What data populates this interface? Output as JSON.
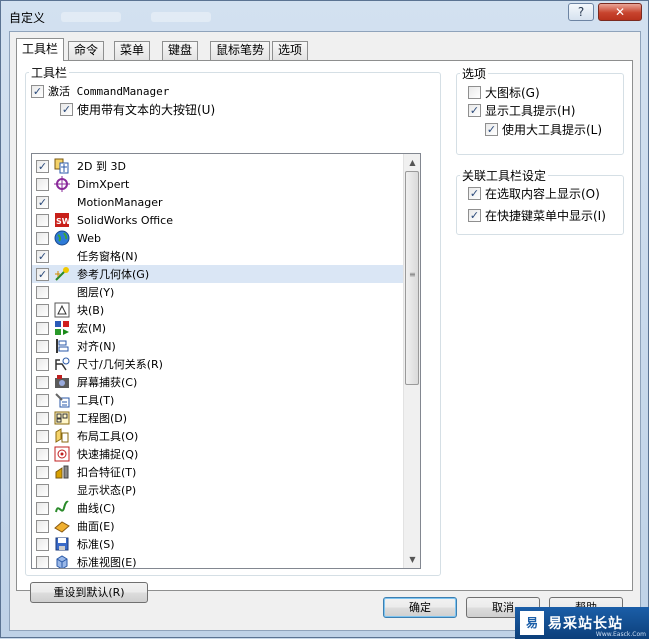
{
  "window": {
    "title": "自定义",
    "help_glyph": "?",
    "close_glyph": "✕"
  },
  "tabs": [
    {
      "label": "工具栏",
      "active": true
    },
    {
      "label": "命令",
      "active": false
    },
    {
      "label": "菜单",
      "active": false
    },
    {
      "label": "键盘",
      "active": false
    },
    {
      "label": "鼠标笔势",
      "active": false
    },
    {
      "label": "选项",
      "active": false
    }
  ],
  "toolbars_group": {
    "label": "工具栏",
    "activate_cm": {
      "label": "激活 CommandManager",
      "checked": true
    },
    "large_buttons_text": {
      "label": "使用带有文本的大按钮(U)",
      "checked": true
    },
    "items": [
      {
        "label": "2D 到 3D",
        "checked": true,
        "icon": "2d-to-3d-icon"
      },
      {
        "label": "DimXpert",
        "checked": false,
        "icon": "dimxpert-icon"
      },
      {
        "label": "MotionManager",
        "checked": true,
        "icon": ""
      },
      {
        "label": "SolidWorks Office",
        "checked": false,
        "icon": "solidworks-office-icon"
      },
      {
        "label": "Web",
        "checked": false,
        "icon": "web-globe-icon"
      },
      {
        "label": "任务窗格(N)",
        "checked": true,
        "icon": ""
      },
      {
        "label": "参考几何体(G)",
        "checked": true,
        "icon": "reference-geometry-icon",
        "selected": true
      },
      {
        "label": "图层(Y)",
        "checked": false,
        "icon": ""
      },
      {
        "label": "块(B)",
        "checked": false,
        "icon": "block-icon"
      },
      {
        "label": "宏(M)",
        "checked": false,
        "icon": "macro-icon"
      },
      {
        "label": "对齐(N)",
        "checked": false,
        "icon": "align-icon"
      },
      {
        "label": "尺寸/几何关系(R)",
        "checked": false,
        "icon": "dimension-relation-icon"
      },
      {
        "label": "屏幕捕获(C)",
        "checked": false,
        "icon": "screen-capture-icon"
      },
      {
        "label": "工具(T)",
        "checked": false,
        "icon": "tools-icon"
      },
      {
        "label": "工程图(D)",
        "checked": false,
        "icon": "drawing-icon"
      },
      {
        "label": "布局工具(O)",
        "checked": false,
        "icon": "layout-tools-icon"
      },
      {
        "label": "快速捕捉(Q)",
        "checked": false,
        "icon": "quick-snap-icon"
      },
      {
        "label": "扣合特征(T)",
        "checked": false,
        "icon": "fastening-feature-icon"
      },
      {
        "label": "显示状态(P)",
        "checked": false,
        "icon": ""
      },
      {
        "label": "曲线(C)",
        "checked": false,
        "icon": "curves-icon"
      },
      {
        "label": "曲面(E)",
        "checked": false,
        "icon": "surfaces-icon"
      },
      {
        "label": "标准(S)",
        "checked": false,
        "icon": "standard-icon"
      },
      {
        "label": "标准视图(E)",
        "checked": false,
        "icon": "standard-views-icon"
      }
    ]
  },
  "options_group": {
    "label": "选项",
    "large_icons": {
      "label": "大图标(G)",
      "checked": false
    },
    "show_tooltips": {
      "label": "显示工具提示(H)",
      "checked": true
    },
    "large_tooltips": {
      "label": "使用大工具提示(L)",
      "checked": true
    }
  },
  "context_group": {
    "label": "关联工具栏设定",
    "show_on_selection": {
      "label": "在选取内容上显示(O)",
      "checked": true
    },
    "show_in_shortcut": {
      "label": "在快捷键菜单中显示(I)",
      "checked": true
    }
  },
  "buttons": {
    "reset": "重设到默认(R)",
    "ok": "确定",
    "cancel": "取消",
    "help": "帮助"
  },
  "watermark": {
    "logo": "易",
    "text": "易采站长站",
    "small": "Www.Easck.Com"
  },
  "glyphs": {
    "check": "✓",
    "up": "▲",
    "down": "▼",
    "grip": "≡"
  }
}
